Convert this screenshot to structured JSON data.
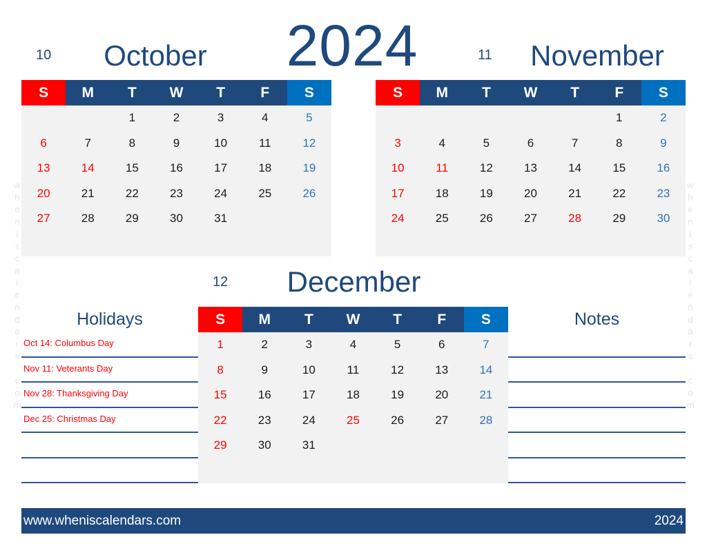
{
  "year": "2024",
  "weekday_headers": [
    "S",
    "M",
    "T",
    "W",
    "T",
    "F",
    "S"
  ],
  "months": [
    {
      "number": "10",
      "name": "October",
      "weeks": [
        [
          "",
          "",
          "1",
          "2",
          "3",
          "4",
          "5"
        ],
        [
          "6",
          "7",
          "8",
          "9",
          "10",
          "11",
          "12"
        ],
        [
          "13",
          "14",
          "15",
          "16",
          "17",
          "18",
          "19"
        ],
        [
          "20",
          "21",
          "22",
          "23",
          "24",
          "25",
          "26"
        ],
        [
          "27",
          "28",
          "29",
          "30",
          "31",
          "",
          ""
        ],
        [
          "",
          "",
          "",
          "",
          "",
          "",
          ""
        ]
      ],
      "holidays": [
        "14"
      ]
    },
    {
      "number": "11",
      "name": "November",
      "weeks": [
        [
          "",
          "",
          "",
          "",
          "",
          "1",
          "2"
        ],
        [
          "3",
          "4",
          "5",
          "6",
          "7",
          "8",
          "9"
        ],
        [
          "10",
          "11",
          "12",
          "13",
          "14",
          "15",
          "16"
        ],
        [
          "17",
          "18",
          "19",
          "20",
          "21",
          "22",
          "23"
        ],
        [
          "24",
          "25",
          "26",
          "27",
          "28",
          "29",
          "30"
        ],
        [
          "",
          "",
          "",
          "",
          "",
          "",
          ""
        ]
      ],
      "holidays": [
        "11",
        "28"
      ]
    },
    {
      "number": "12",
      "name": "December",
      "weeks": [
        [
          "1",
          "2",
          "3",
          "4",
          "5",
          "6",
          "7"
        ],
        [
          "8",
          "9",
          "10",
          "11",
          "12",
          "13",
          "14"
        ],
        [
          "15",
          "16",
          "17",
          "18",
          "19",
          "20",
          "21"
        ],
        [
          "22",
          "23",
          "24",
          "25",
          "26",
          "27",
          "28"
        ],
        [
          "29",
          "30",
          "31",
          "",
          "",
          "",
          ""
        ],
        [
          "",
          "",
          "",
          "",
          "",
          "",
          ""
        ]
      ],
      "holidays": [
        "25"
      ]
    }
  ],
  "holidays_section": {
    "title": "Holidays",
    "items": [
      "Oct 14: Columbus Day",
      "Nov 11: Veterants Day",
      "Nov 28: Thanksgiving Day",
      "Dec 25: Christmas Day",
      "",
      ""
    ]
  },
  "notes_section": {
    "title": "Notes",
    "items": [
      "",
      "",
      "",
      "",
      "",
      ""
    ]
  },
  "watermark_letters": [
    "w",
    "h",
    "e",
    "n",
    "i",
    "s",
    "c",
    "a",
    "l",
    "e",
    "n",
    "d",
    "a",
    "r",
    "s",
    ".",
    "c",
    "o",
    "m"
  ],
  "footer": {
    "website": "www.wheniscalendars.com",
    "year": "2024"
  },
  "colors": {
    "primary": "#1f497d",
    "sunday": "#ff0000",
    "saturday": "#0070c0",
    "holiday": "#ff0000",
    "grid_bg": "#f2f2f2"
  }
}
